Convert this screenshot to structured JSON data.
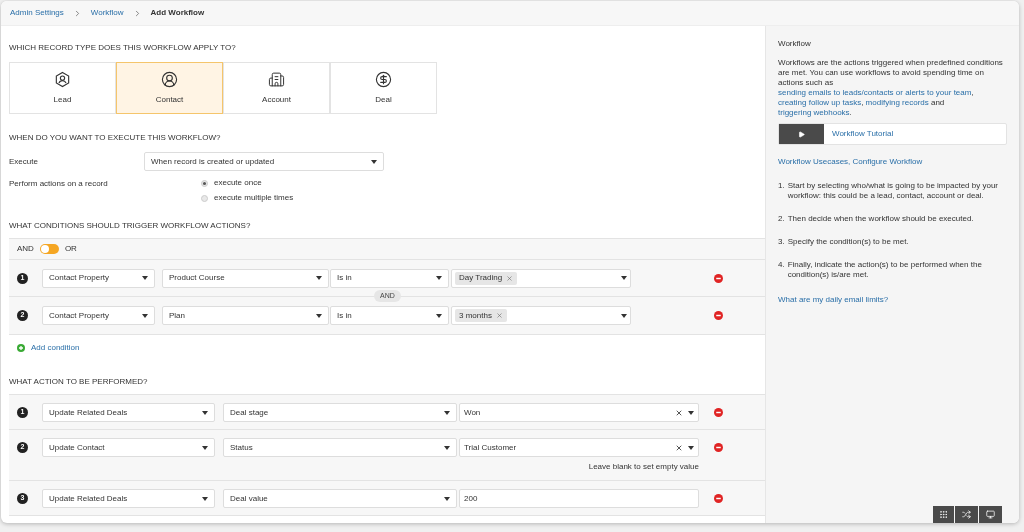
{
  "breadcrumb": [
    {
      "label": "Admin Settings",
      "kind": "link"
    },
    {
      "label": "Workflow",
      "kind": "link"
    },
    {
      "label": "Add Workflow",
      "kind": "current"
    }
  ],
  "record_type": {
    "title": "WHICH RECORD TYPE DOES THIS WORKFLOW APPLY TO?",
    "types": [
      {
        "label": "Lead",
        "kind": "lead",
        "selected": false
      },
      {
        "label": "Contact",
        "kind": "contact",
        "selected": true
      },
      {
        "label": "Account",
        "kind": "account",
        "selected": false
      },
      {
        "label": "Deal",
        "kind": "deal",
        "selected": false
      }
    ]
  },
  "execution": {
    "title": "WHEN DO YOU WANT TO EXECUTE THIS WORKFLOW?",
    "execute_label": "Execute",
    "execute_value": "When record is created or updated",
    "perform_label": "Perform actions on a record",
    "options": [
      {
        "label": "execute once",
        "selected": true
      },
      {
        "label": "execute multiple times",
        "selected": false
      }
    ]
  },
  "conditions": {
    "title": "WHAT CONDITIONS SHOULD TRIGGER WORKFLOW ACTIONS?",
    "and_label": "AND",
    "or_label": "OR",
    "or_selected": false,
    "joiner": "AND",
    "rows": [
      {
        "number": "1",
        "property": "Contact Property",
        "field": "Product Course",
        "operator": "Is in",
        "tags": [
          "Day Trading"
        ]
      },
      {
        "number": "2",
        "property": "Contact Property",
        "field": "Plan",
        "operator": "Is in",
        "tags": [
          "3 months"
        ]
      }
    ],
    "add_label": "Add condition"
  },
  "actions": {
    "title": "WHAT ACTION TO BE PERFORMED?",
    "rows": [
      {
        "number": "1",
        "target": "Update Related Deals",
        "field": "Deal stage",
        "kind": "select",
        "value": "Won"
      },
      {
        "number": "2",
        "target": "Update Contact",
        "field": "Status",
        "kind": "select",
        "value": "Trial Customer",
        "hint": "Leave blank to set empty value"
      },
      {
        "number": "3",
        "target": "Update Related Deals",
        "field": "Deal value",
        "kind": "input",
        "value": "200"
      }
    ]
  },
  "sidebar": {
    "title": "Workflow",
    "description": [
      {
        "text": "Workflows are the actions triggered when predefined conditions are met. You can use workflows to avoid spending time on actions such as ",
        "kind": "text"
      },
      {
        "text": "sending emails to leads/contacts or alerts to your team",
        "kind": "link"
      },
      {
        "text": ", ",
        "kind": "text"
      },
      {
        "text": "creating follow up tasks",
        "kind": "link"
      },
      {
        "text": ", ",
        "kind": "text"
      },
      {
        "text": "modifying records",
        "kind": "link"
      },
      {
        "text": " and ",
        "kind": "text"
      },
      {
        "text": "triggering webhooks",
        "kind": "link"
      },
      {
        "text": ".",
        "kind": "text"
      }
    ],
    "tutorial_label": "Workflow Tutorial",
    "usecases_link": "Workflow Usecases, Configure Workflow",
    "steps": [
      {
        "number": "1.",
        "text": "Start by selecting who/what is going to be impacted by your workflow: this could be a lead, contact, account or deal."
      },
      {
        "number": "2.",
        "text": "Then decide when the workflow should be executed."
      },
      {
        "number": "3.",
        "text": "Specify the condition(s) to be met."
      },
      {
        "number": "4.",
        "text": "Finally, indicate the action(s) to be performed when the condition(s) is/are met."
      }
    ],
    "limits_link": "What are my daily email limits?"
  }
}
